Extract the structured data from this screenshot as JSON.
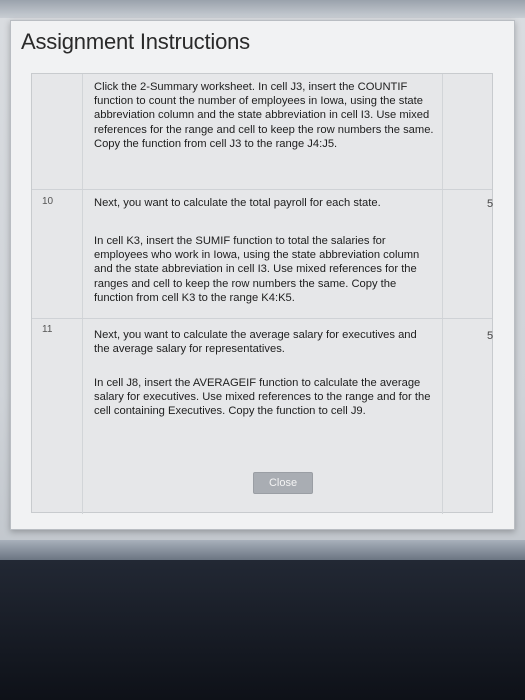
{
  "dialog": {
    "title": "Assignment Instructions",
    "close_label": "Close"
  },
  "steps": [
    {
      "number": "",
      "points": "",
      "paragraphs": [
        "Click the 2-Summary worksheet. In cell J3, insert the COUNTIF function to count the number of employees in Iowa, using the state abbreviation column and the state abbreviation in cell I3. Use mixed references for the range and cell to keep the row numbers the same. Copy the function from cell J3 to the range J4:J5."
      ]
    },
    {
      "number": "10",
      "points": "5",
      "paragraphs": [
        "Next, you want to calculate the total payroll for each state.",
        "In cell K3, insert the SUMIF function to total the salaries for employees who work in Iowa, using the state abbreviation column and the state abbreviation in cell I3. Use mixed references for the ranges and cell to keep the row numbers the same. Copy the function from cell K3 to the range K4:K5."
      ]
    },
    {
      "number": "11",
      "points": "5",
      "paragraphs": [
        "Next, you want to calculate the average salary for executives and the average salary for representatives.",
        "In cell J8, insert the AVERAGEIF function to calculate the average salary for executives. Use mixed references to the range and for the cell containing Executives. Copy the function to cell J9."
      ]
    }
  ]
}
